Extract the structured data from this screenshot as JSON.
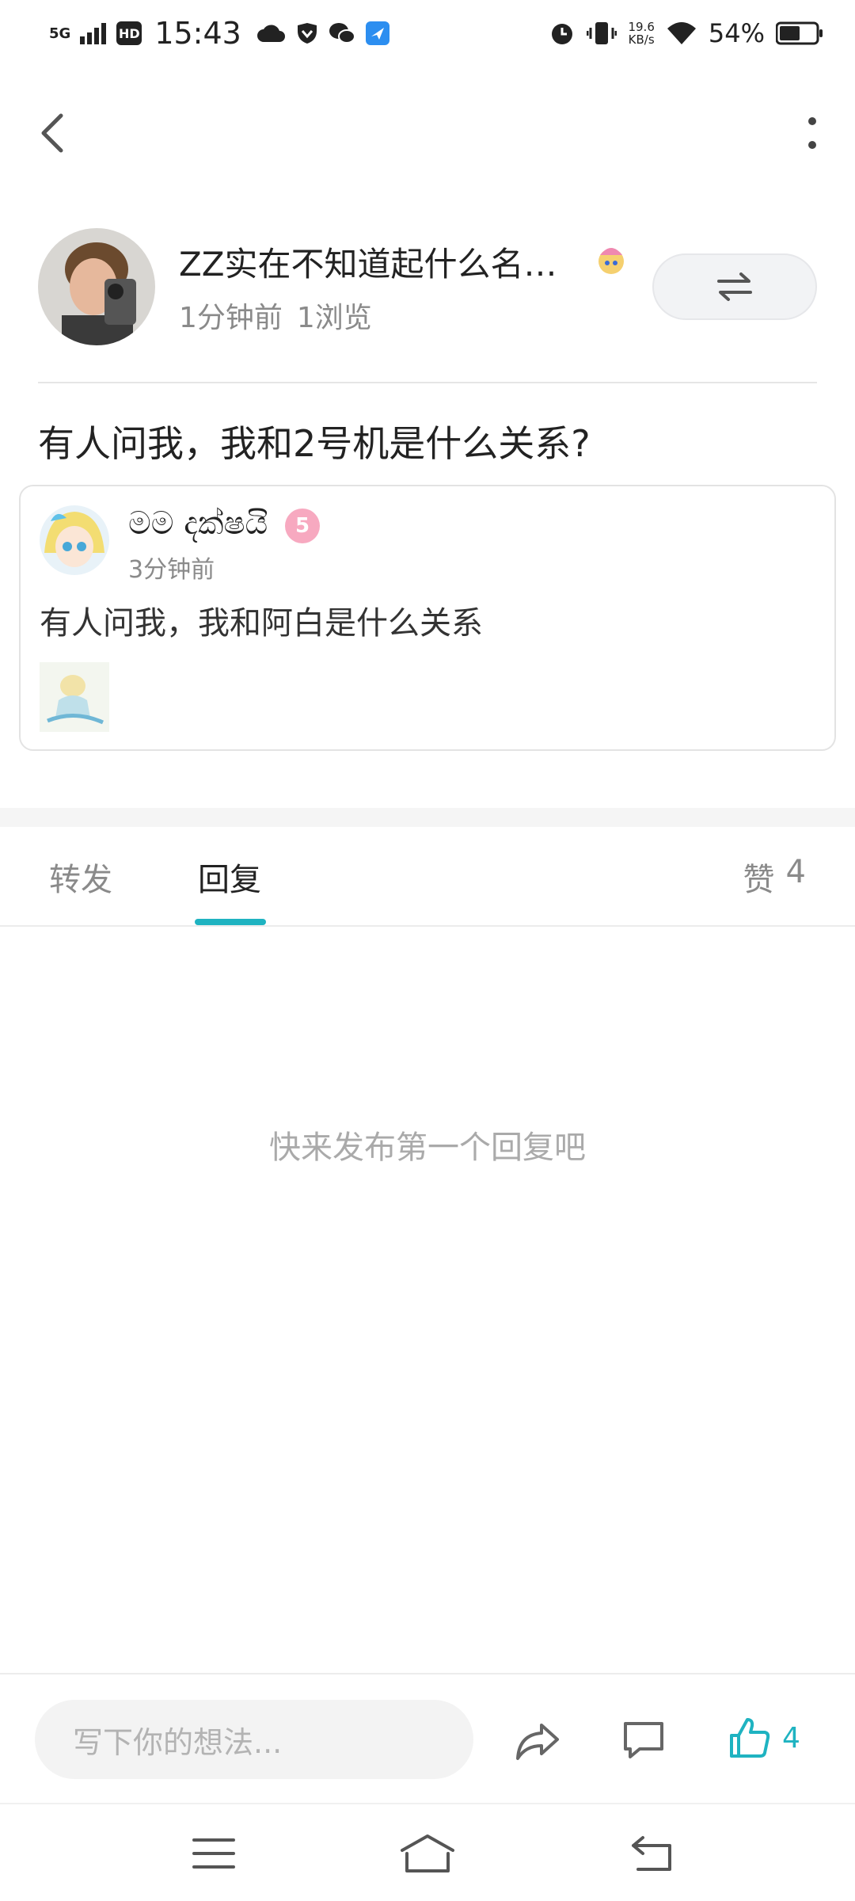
{
  "status_bar": {
    "network": "5G",
    "hd": "HD",
    "time": "15:43",
    "net_speed_value": "19.6",
    "net_speed_unit": "KB/s",
    "battery": "54%"
  },
  "post": {
    "author_name": "ZZ实在不知道起什么名…",
    "time_ago": "1分钟前",
    "views": "1浏览",
    "text": "有人问我，我和2号机是什么关系?",
    "quoted": {
      "author_name": "මම දක්ෂයි",
      "level": "5",
      "time_ago": "3分钟前",
      "text": "有人问我，我和阿白是什么关系"
    }
  },
  "tabs": {
    "repost": "转发",
    "replies": "回复",
    "likes_label": "赞",
    "likes_count": "4",
    "active": "replies"
  },
  "empty_hint": "快来发布第一个回复吧",
  "bottom_bar": {
    "input_placeholder": "写下你的想法...",
    "like_count": "4"
  },
  "colors": {
    "accent": "#1fb3c1",
    "muted_text": "#8a8a8a",
    "level_badge": "#f7a9c0"
  },
  "icons": [
    "back-chevron-icon",
    "more-vertical-icon",
    "swap-arrows-icon",
    "share-arrow-icon",
    "comment-bubble-icon",
    "thumbs-up-icon",
    "menu-lines-icon",
    "home-icon",
    "back-arrow-icon"
  ]
}
